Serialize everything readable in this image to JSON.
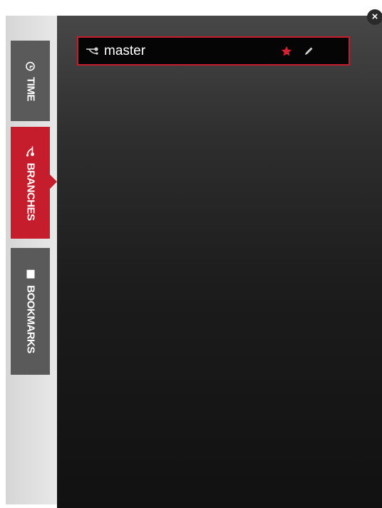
{
  "tabs": [
    {
      "id": "time",
      "label": "TIME",
      "icon": "clock-icon",
      "active": false
    },
    {
      "id": "branches",
      "label": "BRANCHES",
      "icon": "branch-icon",
      "active": true
    },
    {
      "id": "bookmarks",
      "label": "BOOKMARKS",
      "icon": "bookmark-icon",
      "active": false
    }
  ],
  "branches": [
    {
      "name": "master",
      "starred": true,
      "icons": [
        "branch-icon",
        "star-icon",
        "pencil-icon"
      ]
    }
  ],
  "close": {
    "label": "×",
    "icon": "close-icon"
  },
  "colors": {
    "accent": "#c61d2c",
    "tab_inactive": "#5a5a5a",
    "panel_top": "#474747",
    "panel_bottom": "#111111",
    "sidebar": "#e0e0e0"
  }
}
